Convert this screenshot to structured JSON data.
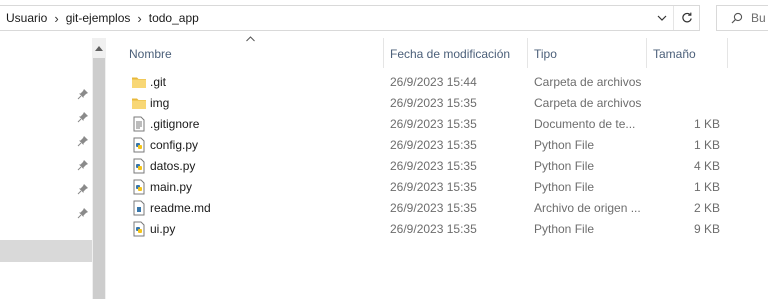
{
  "breadcrumb": [
    "Usuario",
    "git-ejemplos",
    "todo_app"
  ],
  "search": {
    "text": "Bu"
  },
  "columns": {
    "name": "Nombre",
    "date": "Fecha de modificación",
    "type": "Tipo",
    "size": "Tamaño"
  },
  "files": [
    {
      "name": ".git",
      "date": "26/9/2023 15:44",
      "type": "Carpeta de archivos",
      "size": "",
      "icon": "folder-icon"
    },
    {
      "name": "img",
      "date": "26/9/2023 15:35",
      "type": "Carpeta de archivos",
      "size": "",
      "icon": "folder-icon"
    },
    {
      "name": ".gitignore",
      "date": "26/9/2023 15:35",
      "type": "Documento de te...",
      "size": "1 KB",
      "icon": "text-file-icon"
    },
    {
      "name": "config.py",
      "date": "26/9/2023 15:35",
      "type": "Python File",
      "size": "1 KB",
      "icon": "python-file-icon"
    },
    {
      "name": "datos.py",
      "date": "26/9/2023 15:35",
      "type": "Python File",
      "size": "4 KB",
      "icon": "python-file-icon"
    },
    {
      "name": "main.py",
      "date": "26/9/2023 15:35",
      "type": "Python File",
      "size": "1 KB",
      "icon": "python-file-icon"
    },
    {
      "name": "readme.md",
      "date": "26/9/2023 15:35",
      "type": "Archivo de origen ...",
      "size": "2 KB",
      "icon": "markdown-file-icon"
    },
    {
      "name": "ui.py",
      "date": "26/9/2023 15:35",
      "type": "Python File",
      "size": "9 KB",
      "icon": "python-file-icon"
    }
  ],
  "colors": {
    "folder": "#f8d775",
    "python_blue": "#3776ab",
    "header_text": "#4c607a"
  }
}
